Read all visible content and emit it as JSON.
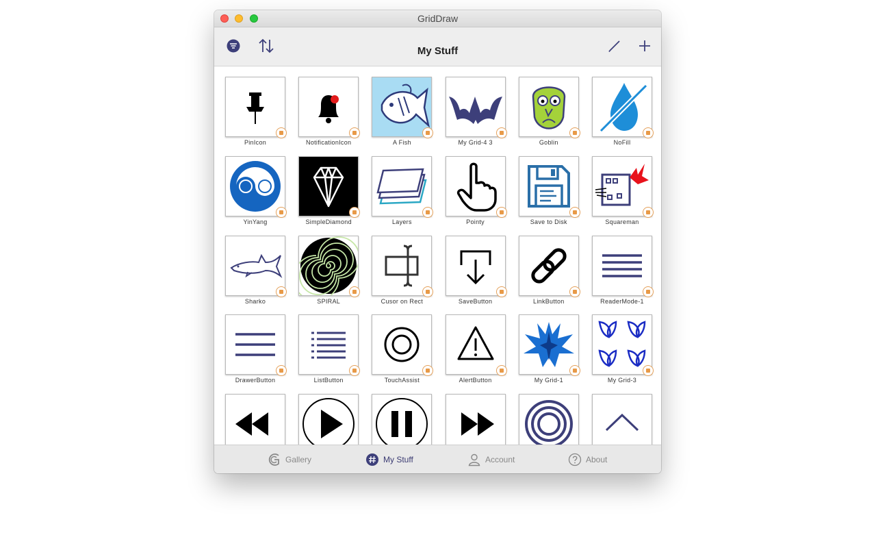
{
  "window": {
    "title": "GridDraw"
  },
  "toolbar": {
    "title": "My Stuff",
    "accent": "#3d3f7a"
  },
  "grid": {
    "items": [
      {
        "label": "PinIcon",
        "icon": "pin-icon"
      },
      {
        "label": "NotificationIcon",
        "icon": "bell-icon"
      },
      {
        "label": "A Fish",
        "icon": "fish-icon"
      },
      {
        "label": "My Grid-4 3",
        "icon": "bat-icon"
      },
      {
        "label": "Goblin",
        "icon": "goblin-icon"
      },
      {
        "label": "NoFill",
        "icon": "no-fill-drop-icon"
      },
      {
        "label": "YinYang",
        "icon": "yin-yang-icon"
      },
      {
        "label": "SimpleDiamond",
        "icon": "diamond-icon"
      },
      {
        "label": "Layers",
        "icon": "layers-icon"
      },
      {
        "label": "Pointy",
        "icon": "pointing-hand-icon"
      },
      {
        "label": "Save to Disk",
        "icon": "floppy-disk-icon"
      },
      {
        "label": "Squareman",
        "icon": "squareman-icon"
      },
      {
        "label": "Sharko",
        "icon": "shark-icon"
      },
      {
        "label": "SPIRAL",
        "icon": "spiral-icon"
      },
      {
        "label": "Cusor on Rect",
        "icon": "cursor-on-rect-icon"
      },
      {
        "label": "SaveButton",
        "icon": "save-arrow-icon"
      },
      {
        "label": "LinkButton",
        "icon": "link-icon"
      },
      {
        "label": "ReaderMode-1",
        "icon": "reader-mode-icon"
      },
      {
        "label": "DrawerButton",
        "icon": "drawer-icon"
      },
      {
        "label": "ListButton",
        "icon": "list-icon"
      },
      {
        "label": "TouchAssist",
        "icon": "touch-assist-icon"
      },
      {
        "label": "AlertButton",
        "icon": "alert-icon"
      },
      {
        "label": "My Grid-1",
        "icon": "blue-phoenix-icon"
      },
      {
        "label": "My Grid-3",
        "icon": "blue-pattern-icon"
      },
      {
        "label": "",
        "icon": "rewind-icon"
      },
      {
        "label": "",
        "icon": "play-icon"
      },
      {
        "label": "",
        "icon": "pause-icon"
      },
      {
        "label": "",
        "icon": "fast-forward-icon"
      },
      {
        "label": "",
        "icon": "concentric-circles-icon"
      },
      {
        "label": "",
        "icon": "chevron-up-icon"
      }
    ]
  },
  "tabs": [
    {
      "label": "Gallery",
      "icon": "gallery-icon",
      "active": false
    },
    {
      "label": "My Stuff",
      "icon": "grid-hash-icon",
      "active": true
    },
    {
      "label": "Account",
      "icon": "person-icon",
      "active": false
    },
    {
      "label": "About",
      "icon": "question-icon",
      "active": false
    }
  ]
}
